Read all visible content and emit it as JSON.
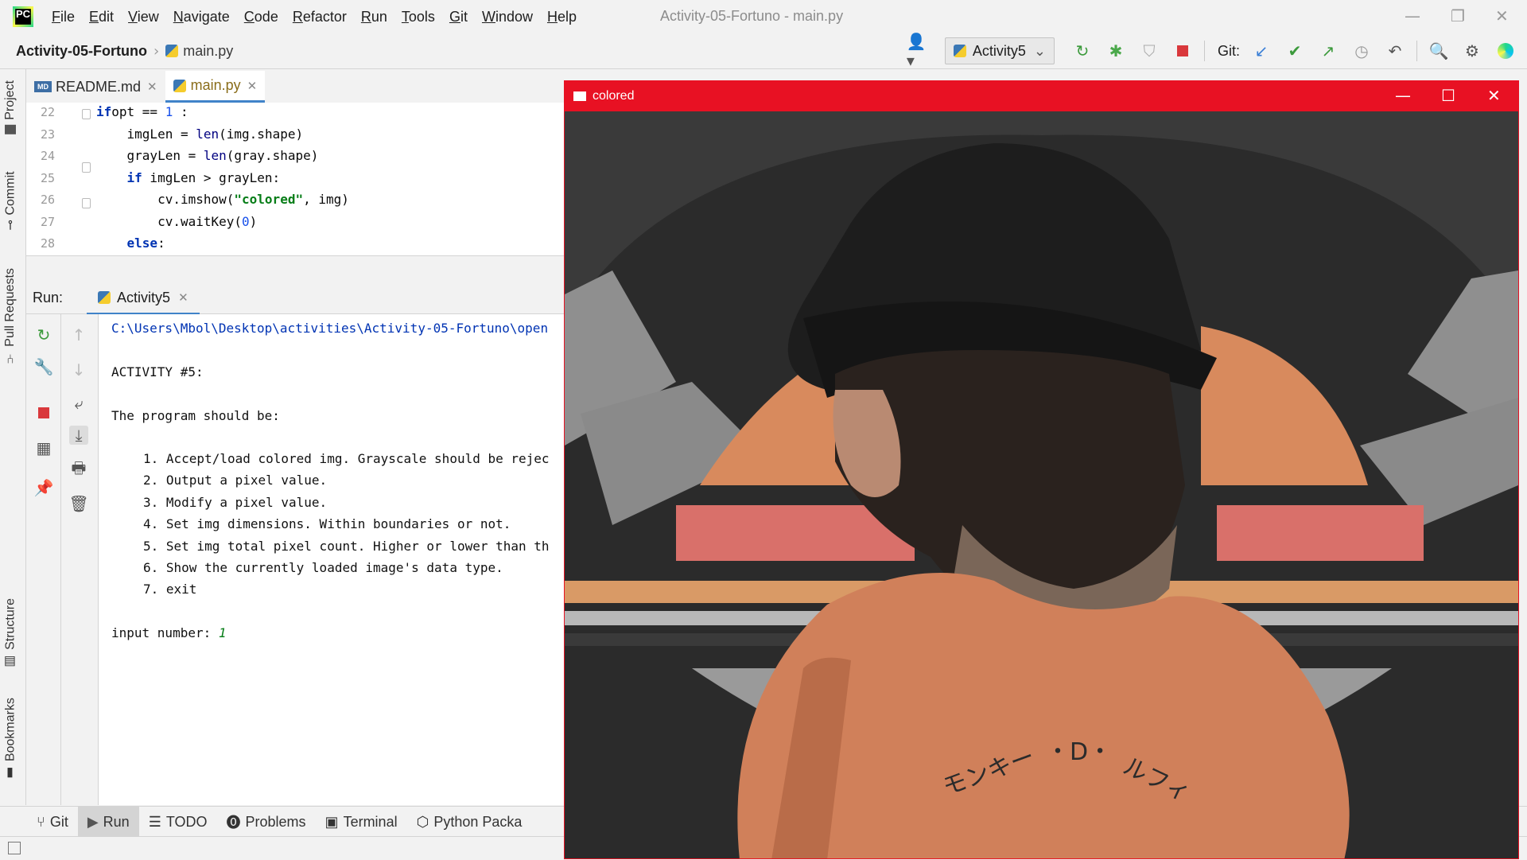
{
  "menu": {
    "items": [
      "File",
      "Edit",
      "View",
      "Navigate",
      "Code",
      "Refactor",
      "Run",
      "Tools",
      "Git",
      "Window",
      "Help"
    ],
    "window_title": "Activity-05-Fortuno - main.py"
  },
  "nav": {
    "project": "Activity-05-Fortuno",
    "file": "main.py",
    "run_config": "Activity5",
    "git_label": "Git:"
  },
  "left_strip": {
    "project": "Project",
    "commit": "Commit",
    "pull_requests": "Pull Requests",
    "structure": "Structure",
    "bookmarks": "Bookmarks"
  },
  "editor": {
    "tabs": [
      {
        "label": "README.md",
        "icon": "markdown-file-icon",
        "badge": "MD"
      },
      {
        "label": "main.py",
        "icon": "python-file-icon",
        "active": true
      }
    ],
    "lines": [
      {
        "n": "22",
        "parts": [
          [
            "kw",
            "if"
          ],
          [
            "",
            "opt == "
          ],
          [
            "num",
            "1"
          ],
          [
            "",
            " :"
          ]
        ]
      },
      {
        "n": "23",
        "parts": [
          [
            "",
            "    imgLen = "
          ],
          [
            "fn",
            "len"
          ],
          [
            "",
            "(img.shape)"
          ]
        ]
      },
      {
        "n": "24",
        "parts": [
          [
            "",
            "    grayLen = "
          ],
          [
            "fn",
            "len"
          ],
          [
            "",
            "(gray.shape)"
          ]
        ]
      },
      {
        "n": "25",
        "parts": [
          [
            "",
            "    "
          ],
          [
            "kw",
            "if"
          ],
          [
            "",
            " imgLen > grayLen:"
          ]
        ]
      },
      {
        "n": "26",
        "parts": [
          [
            "",
            "        cv.imshow("
          ],
          [
            "str",
            "\"colored\""
          ],
          [
            "",
            ", img)"
          ]
        ]
      },
      {
        "n": "27",
        "parts": [
          [
            "",
            "        cv.waitKey("
          ],
          [
            "num",
            "0"
          ],
          [
            "",
            ")"
          ]
        ]
      },
      {
        "n": "28",
        "parts": [
          [
            "",
            "    "
          ],
          [
            "kw",
            "else"
          ],
          [
            "",
            ":"
          ]
        ]
      }
    ]
  },
  "run": {
    "label": "Run:",
    "tab": "Activity5",
    "console": {
      "path": "C:\\Users\\Mbol\\Desktop\\activities\\Activity-05-Fortuno\\open",
      "heading": "ACTIVITY #5:",
      "intro": "The program should be:",
      "options": [
        "1. Accept/load colored img. Grayscale should be rejec",
        "2. Output a pixel value.",
        "3. Modify a pixel value.",
        "4. Set img dimensions. Within boundaries or not.",
        "5. Set img total pixel count. Higher or lower than th",
        "6. Show the currently loaded image's data type.",
        "7. exit"
      ],
      "prompt": "input number: ",
      "input_value": "1"
    }
  },
  "bottom": {
    "tabs": [
      "Git",
      "Run",
      "TODO",
      "Problems",
      "Terminal",
      "Python Packa"
    ]
  },
  "cv_window": {
    "title": "colored"
  },
  "colors": {
    "cv_titlebar": "#e81123",
    "tab_underline": "#4083c9",
    "keyword": "#0033b3",
    "string": "#067d17"
  }
}
